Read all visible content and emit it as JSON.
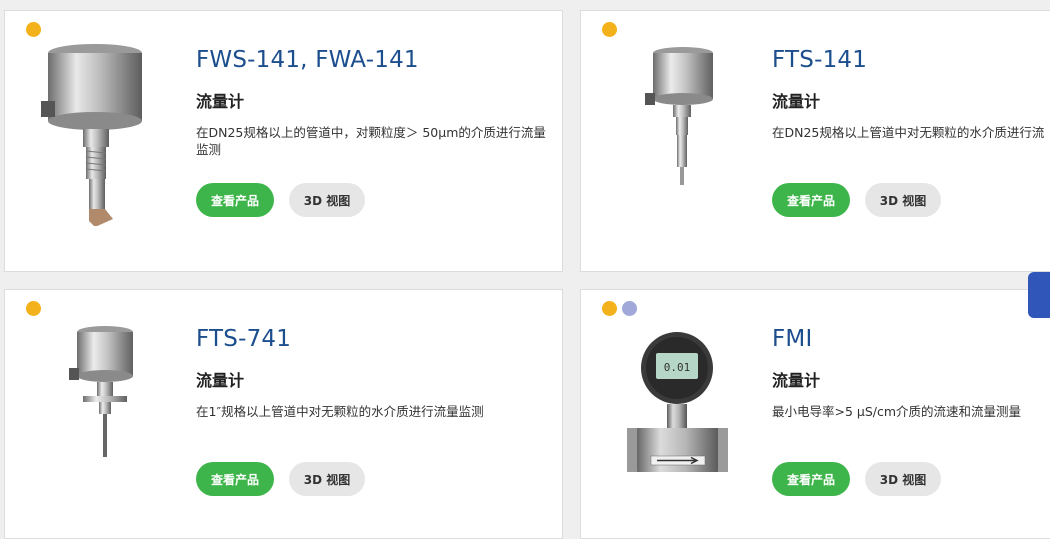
{
  "products": [
    {
      "title": "FWS-141, FWA-141",
      "subtitle": "流量计",
      "desc": "在DN25规格以上的管道中，对颗粒度＞ 50μm的介质进行流量监测",
      "btn_primary": "查看产品",
      "btn_secondary": "3D 视图"
    },
    {
      "title": "FTS-141",
      "subtitle": "流量计",
      "desc": "在DN25规格以上管道中对无颗粒的水介质进行流",
      "btn_primary": "查看产品",
      "btn_secondary": "3D 视图"
    },
    {
      "title": "FTS-741",
      "subtitle": "流量计",
      "desc": "在1″规格以上管道中对无颗粒的水介质进行流量监测",
      "btn_primary": "查看产品",
      "btn_secondary": "3D 视图"
    },
    {
      "title": "FMI",
      "subtitle": "流量计",
      "desc": "最小电导率>5 µS/cm介质的流速和流量测量",
      "btn_primary": "查看产品",
      "btn_secondary": "3D 视图",
      "display_value": "0.01"
    }
  ],
  "colors": {
    "title": "#1c4e8e",
    "primary_button": "#3eb54a",
    "secondary_button": "#e6e6e6",
    "dot_yellow": "#f3b21b",
    "dot_lilac": "#9fa8d8",
    "side_tab": "#2f56b8"
  }
}
